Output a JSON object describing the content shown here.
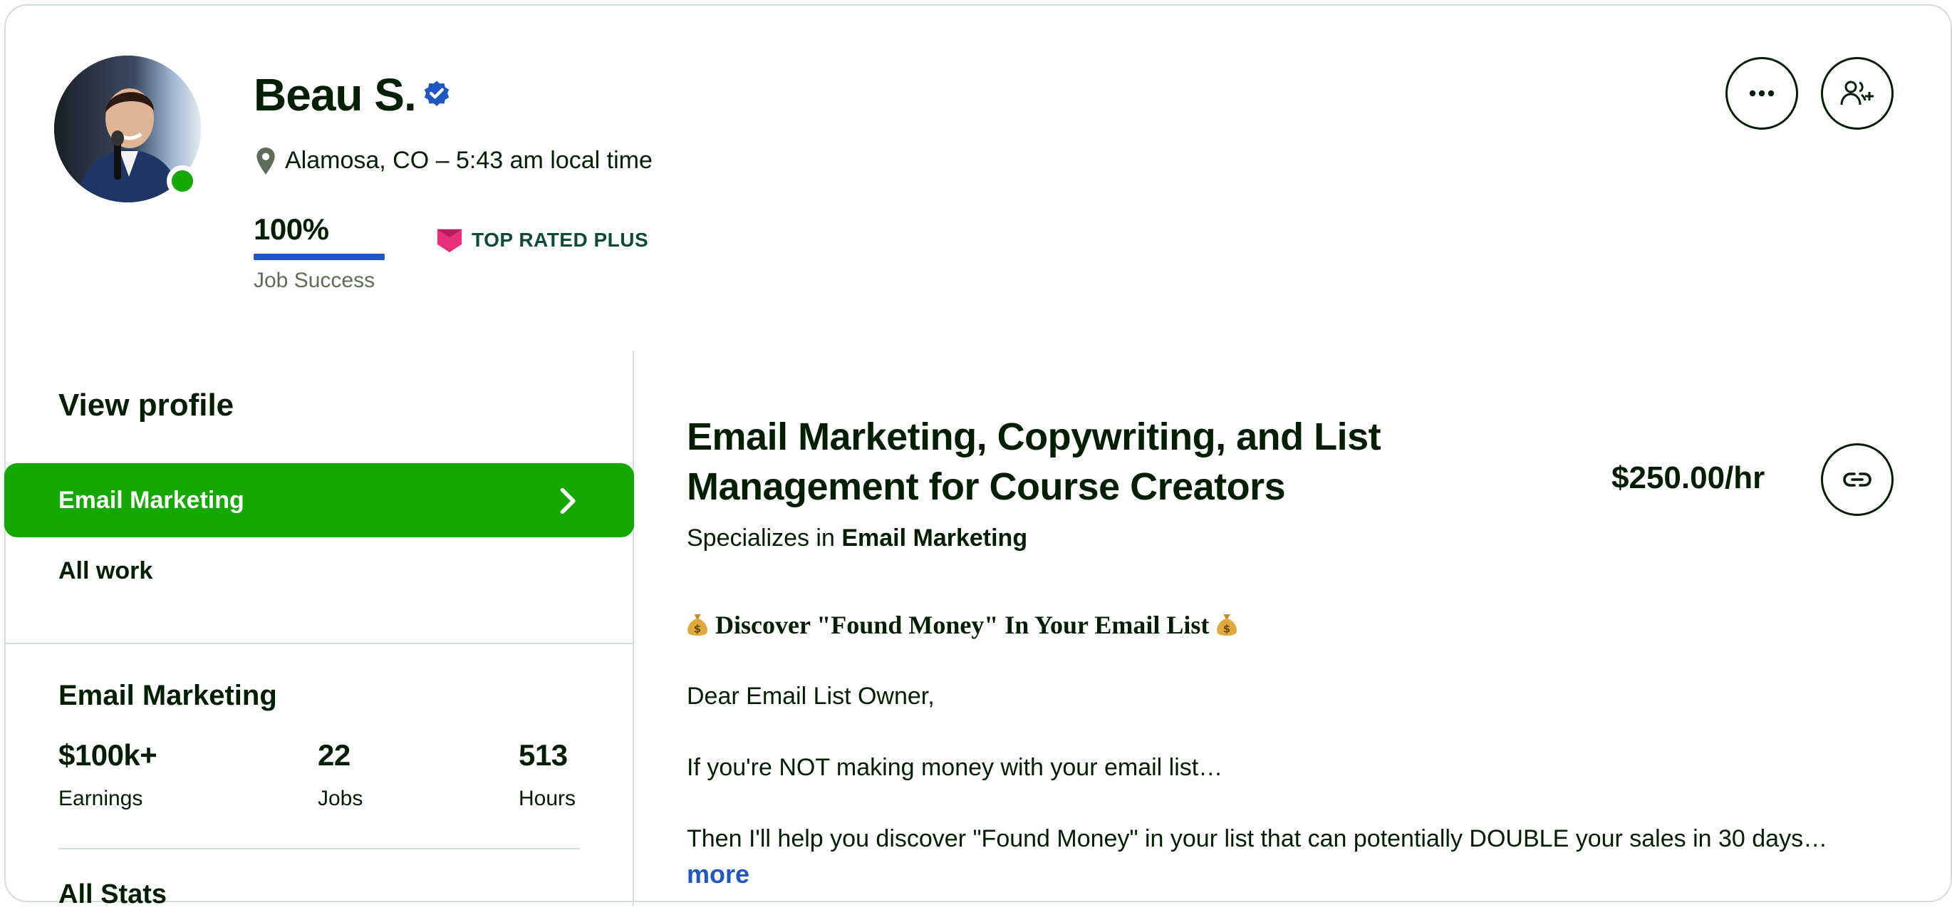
{
  "profile": {
    "name": "Beau S.",
    "location": "Alamosa, CO – 5:43 am local time",
    "job_success_value": "100%",
    "job_success_fraction": 1.0,
    "job_success_label": "Job Success",
    "badge_label": "TOP RATED PLUS",
    "online": true
  },
  "actions": {
    "more_icon": "ellipsis-icon",
    "invite_icon": "add-person-icon",
    "link_icon": "link-icon"
  },
  "sidebar": {
    "view_profile": "View profile",
    "items": [
      {
        "label": "Email Marketing",
        "active": true
      },
      {
        "label": "All work",
        "active": false
      }
    ],
    "stats_title": "Email Marketing",
    "stats": [
      {
        "value": "$100k+",
        "label": "Earnings"
      },
      {
        "value": "22",
        "label": "Jobs"
      },
      {
        "value": "513",
        "label": "Hours"
      }
    ],
    "all_stats": "All Stats"
  },
  "main": {
    "title_line1": "Email Marketing, Copywriting, and List",
    "title_line2": "Management for Course Creators",
    "rate": "$250.00/hr",
    "specializes_prefix": "Specializes in",
    "specializes_value": "Email Marketing",
    "description": {
      "heading": "Discover \"Found Money\" In Your Email List",
      "greeting": "Dear Email List Owner,",
      "line2": "If you're NOT making money with your email list…",
      "line3": "Then I'll help you discover \"Found Money\" in your list that can potentially DOUBLE your sales in 30 days…",
      "more": "more"
    }
  },
  "colors": {
    "brand_green": "#14a800",
    "text": "#001e00",
    "link_blue": "#1f57c3",
    "badge_pink": "#e8317a"
  }
}
